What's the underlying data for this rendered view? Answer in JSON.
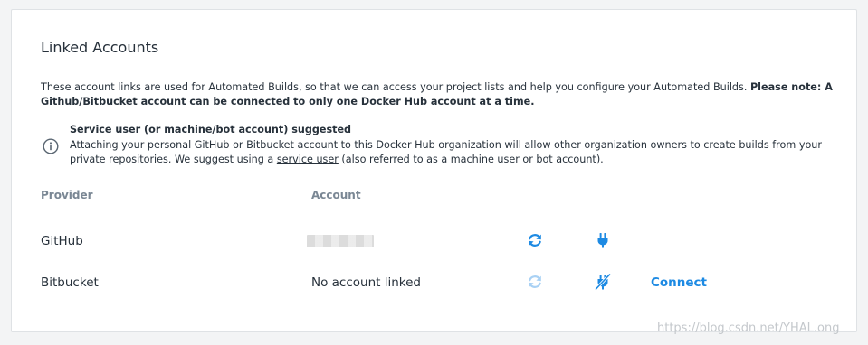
{
  "card": {
    "title": "Linked Accounts",
    "intro_text": "These account links are used for Automated Builds, so that we can access your project lists and help you configure your Automated Builds. ",
    "intro_bold": "Please note: A Github/Bitbucket account can be connected to only one Docker Hub account at a time."
  },
  "notice": {
    "icon": "info-circle-icon",
    "title": "Service user (or machine/bot account) suggested",
    "body_before": "Attaching your personal GitHub or Bitbucket account to this Docker Hub organization will allow other organization owners to create builds from your private repositories. We suggest using a ",
    "link": "service user",
    "body_after": " (also referred to as a machine user or bot account)."
  },
  "table": {
    "headers": [
      "Provider",
      "Account"
    ],
    "rows": [
      {
        "provider": "GitHub",
        "account": "",
        "refresh_icon": "refresh-icon",
        "plug_icon": "plug-icon",
        "action": ""
      },
      {
        "provider": "Bitbucket",
        "account": "No account linked",
        "refresh_icon": "refresh-disabled-icon",
        "plug_icon": "unplugged-icon",
        "action": "Connect"
      }
    ]
  },
  "watermark": "https://blog.csdn.net/YHAL.ong",
  "colors": {
    "accent": "#1d8ae3",
    "accent_disabled": "#a9d1f4",
    "text": "#27313b",
    "muted": "#7a8794"
  }
}
